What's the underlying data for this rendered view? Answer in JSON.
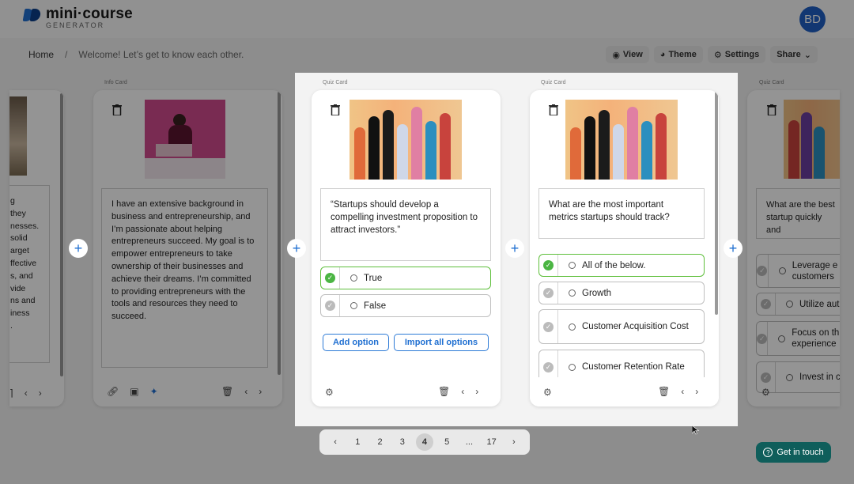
{
  "logo": {
    "title": "mini·course",
    "subtitle": "GENERATOR"
  },
  "user": {
    "initials": "BD"
  },
  "breadcrumb": {
    "home": "Home",
    "separator": "/",
    "current": "Welcome! Let’s get to know each other."
  },
  "toolbar": {
    "view": "View",
    "theme": "Theme",
    "settings": "Settings",
    "share": "Share"
  },
  "cards": {
    "left_partial": {
      "text_lines": [
        "g",
        "they",
        "nesses.",
        "solid",
        "arget",
        "ffective",
        "s, and",
        "vide",
        "ns and",
        "iness",
        "."
      ]
    },
    "info": {
      "label": "Info Card",
      "text": "I have an extensive background in business and entrepreneurship, and I’m passionate about helping entrepreneurs succeed. My goal is to empower entrepreneurs to take ownership of their businesses and achieve their dreams. I’m committed to providing entrepreneurs with the tools and resources they need to succeed."
    },
    "quiz1": {
      "label": "Quiz Card",
      "question": "“Startups should develop a compelling investment proposition to attract investors.”",
      "options": [
        {
          "label": "True",
          "correct": true
        },
        {
          "label": "False",
          "correct": false
        }
      ],
      "add_option": "Add option",
      "import_all": "Import all options"
    },
    "quiz2": {
      "label": "Quiz Card",
      "question": "What are the most important metrics startups should track?",
      "options": [
        {
          "label": "All of the below.",
          "correct": true
        },
        {
          "label": "Growth",
          "correct": false
        },
        {
          "label": "Customer Acquisition Cost",
          "correct": false
        },
        {
          "label": "Customer Retention Rate",
          "correct": false
        }
      ]
    },
    "quiz3": {
      "label": "Quiz Card",
      "question": "What are the best startup quickly and",
      "options": [
        {
          "label": "Leverage e customers"
        },
        {
          "label": "Utilize auto"
        },
        {
          "label": "Focus on th experience"
        },
        {
          "label": "Invest in co"
        }
      ]
    }
  },
  "pagination": {
    "prev": "‹",
    "next": "›",
    "pages": [
      "1",
      "2",
      "3",
      "4",
      "5",
      "...",
      "17"
    ],
    "active": "4"
  },
  "contact": {
    "label": "Get in touch"
  },
  "colors": {
    "accent": "#1f6fd1",
    "correct": "#4bb543",
    "contact_bg": "#0f5e5b"
  }
}
